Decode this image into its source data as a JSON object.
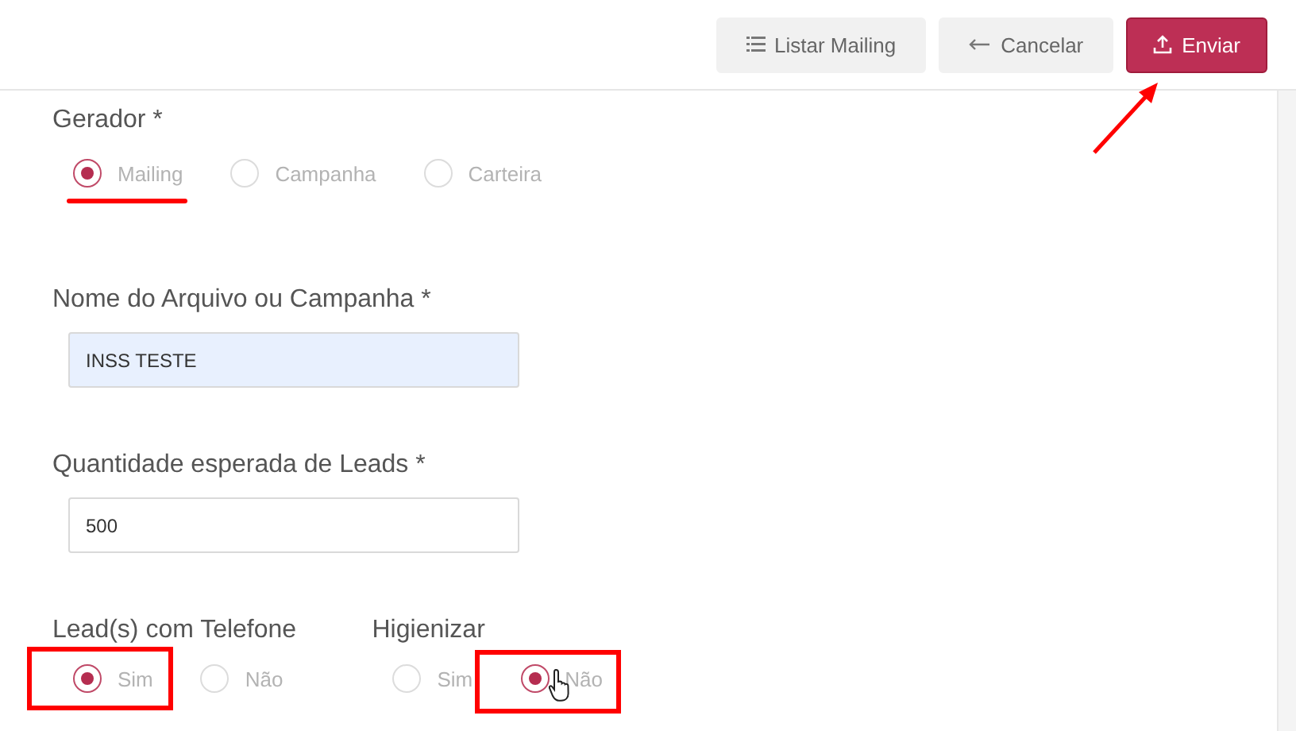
{
  "header": {
    "buttons": [
      {
        "label": "Listar Mailing",
        "kind": "list"
      },
      {
        "label": "Cancelar",
        "kind": "back"
      },
      {
        "label": "Enviar",
        "kind": "upload"
      }
    ]
  },
  "gerador": {
    "label": "Gerador *",
    "options": [
      {
        "label": "Mailing",
        "selected": true
      },
      {
        "label": "Campanha",
        "selected": false
      },
      {
        "label": "Carteira",
        "selected": false
      }
    ]
  },
  "fields": [
    {
      "label": "Nome do Arquivo ou Campanha *",
      "value": "INSS TESTE",
      "autofilled": true
    },
    {
      "label": "Quantidade esperada de Leads *",
      "value": "500",
      "autofilled": false
    }
  ],
  "groups": [
    {
      "label": "Lead(s) com Telefone",
      "options": [
        {
          "label": "Sim",
          "selected": true
        },
        {
          "label": "Não",
          "selected": false
        }
      ]
    },
    {
      "label": "Higienizar",
      "options": [
        {
          "label": "Sim",
          "selected": false
        },
        {
          "label": "Não",
          "selected": true
        }
      ]
    }
  ]
}
